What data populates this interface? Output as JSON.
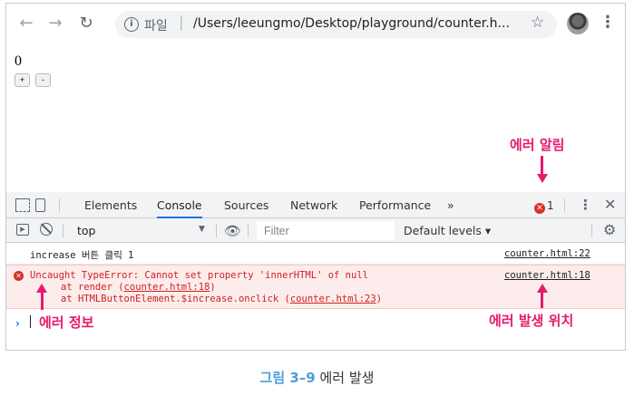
{
  "browser": {
    "url_label": "파일",
    "url": "/Users/leeungmo/Desktop/playground/counter.h...",
    "icons": [
      "back-icon",
      "forward-icon",
      "reload-icon",
      "info-icon",
      "star-icon",
      "profile-avatar",
      "menu-icon"
    ]
  },
  "page": {
    "counter_value": "0",
    "increase_label": "+",
    "decrease_label": "-"
  },
  "devtools": {
    "tabs": [
      "Elements",
      "Console",
      "Sources",
      "Network",
      "Performance"
    ],
    "active_tab": "Console",
    "more_tabs": "»",
    "error_count": "1",
    "close": "✕",
    "context": "top",
    "filter_placeholder": "Filter",
    "levels": "Default levels ▾",
    "console": {
      "log_message": "increase 버튼 클릭 1",
      "log_source": "counter.html:22",
      "error_message": "Uncaught TypeError: Cannot set property 'innerHTML' of null",
      "error_source": "counter.html:18",
      "stack": [
        {
          "prefix": "at render (",
          "link": "counter.html:18",
          "suffix": ")"
        },
        {
          "prefix": "at HTMLButtonElement.$increase.onclick (",
          "link": "counter.html:23",
          "suffix": ")"
        }
      ],
      "prompt": "›"
    }
  },
  "annotations": {
    "error_alert": "에러 알림",
    "error_info": "에러 정보",
    "error_location": "에러 발생 위치",
    "color": "#e6196b"
  },
  "caption": {
    "number": "그림 3–9",
    "text": "에러 발생"
  }
}
